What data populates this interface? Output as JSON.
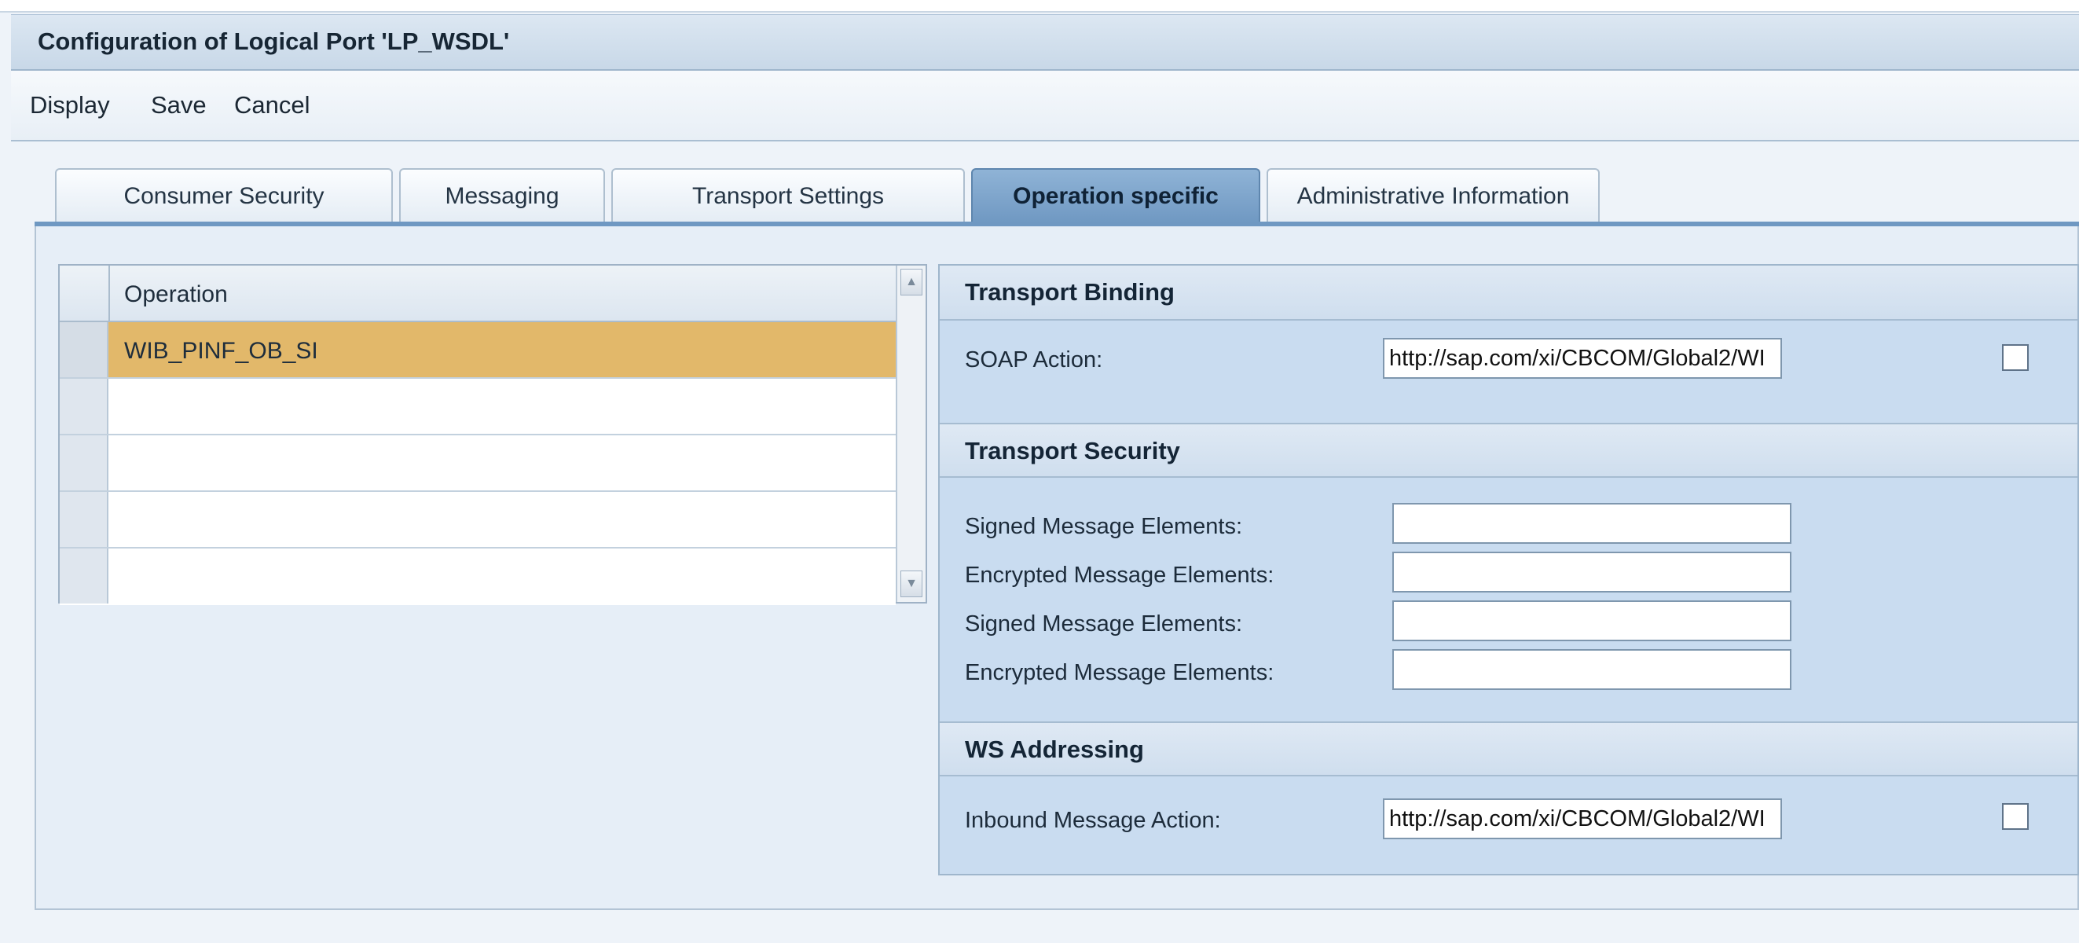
{
  "title": "Configuration of Logical Port 'LP_WSDL'",
  "toolbar": {
    "display": "Display",
    "save": "Save",
    "cancel": "Cancel"
  },
  "tabs": [
    {
      "label": "Consumer Security"
    },
    {
      "label": "Messaging"
    },
    {
      "label": "Transport Settings"
    },
    {
      "label": "Operation specific",
      "active": true
    },
    {
      "label": "Administrative Information"
    }
  ],
  "operations": {
    "header": "Operation",
    "rows": [
      "WIB_PINF_OB_SI",
      "",
      "",
      "",
      ""
    ],
    "selected_index": 0
  },
  "transport_binding": {
    "title": "Transport Binding",
    "soap_action_label": "SOAP Action:",
    "soap_action_value": "http://sap.com/xi/CBCOM/Global2/WI"
  },
  "transport_security": {
    "title": "Transport Security",
    "fields": [
      {
        "label": "Signed Message Elements:",
        "value": ""
      },
      {
        "label": "Encrypted Message Elements:",
        "value": ""
      },
      {
        "label": "Signed Message Elements:",
        "value": ""
      },
      {
        "label": "Encrypted Message Elements:",
        "value": ""
      }
    ]
  },
  "ws_addressing": {
    "title": "WS Addressing",
    "inbound_label": "Inbound Message Action:",
    "inbound_value": "http://sap.com/xi/CBCOM/Global2/WI"
  },
  "colors": {
    "selected_row": "#e2b86a",
    "active_tab": "#6f98c2",
    "panel_bg": "#c9dcf0"
  },
  "icons": {
    "scroll_up": "scroll-up-arrow-icon",
    "scroll_down": "scroll-down-arrow-icon"
  }
}
